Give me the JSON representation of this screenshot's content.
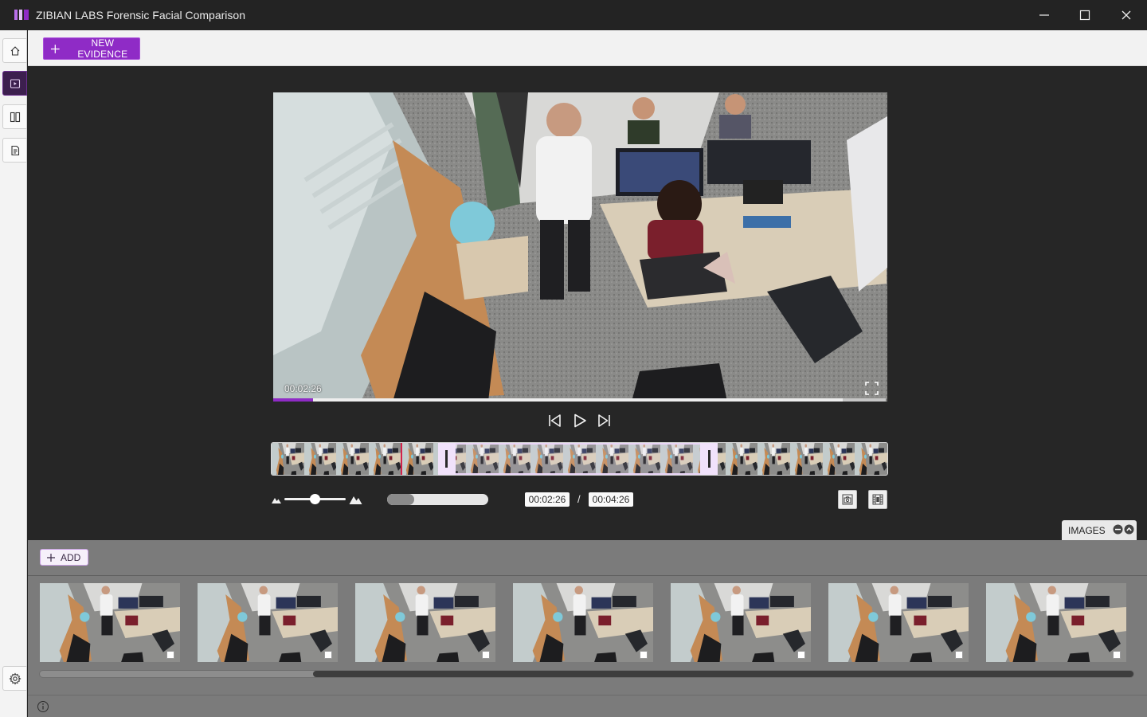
{
  "app": {
    "title": "ZIBIAN LABS Forensic Facial Comparison",
    "accent": "#8f2bc6"
  },
  "window_controls": [
    "minimize-icon",
    "maximize-icon",
    "close-icon"
  ],
  "rail": {
    "items": [
      {
        "name": "home",
        "icon": "home-icon",
        "active": false
      },
      {
        "name": "video-evidence",
        "icon": "video-icon",
        "active": true
      },
      {
        "name": "comparison",
        "icon": "columns-icon",
        "active": false
      },
      {
        "name": "report",
        "icon": "document-icon",
        "active": false
      }
    ],
    "settings_icon": "gear-icon"
  },
  "toolbar": {
    "new_evidence_label": "NEW EVIDENCE"
  },
  "player": {
    "current_time": "00:02:26",
    "progress_fraction": 0.065,
    "buffer_fraction": 0.93
  },
  "timeline": {
    "playhead_fraction": 0.21,
    "selection_start_fraction": 0.27,
    "selection_end_fraction": 0.725,
    "frame_count": 19
  },
  "controls": {
    "zoom_fraction": 0.5,
    "speed_fraction": 0.27,
    "current_time": "00:02:26",
    "separator": "/",
    "total_time": "00:04:26"
  },
  "images_tab": {
    "label": "IMAGES"
  },
  "images_panel": {
    "add_label": "ADD",
    "thumbnail_count": 7,
    "scroll_start_fraction": 0.25,
    "scroll_end_fraction": 1.0
  }
}
